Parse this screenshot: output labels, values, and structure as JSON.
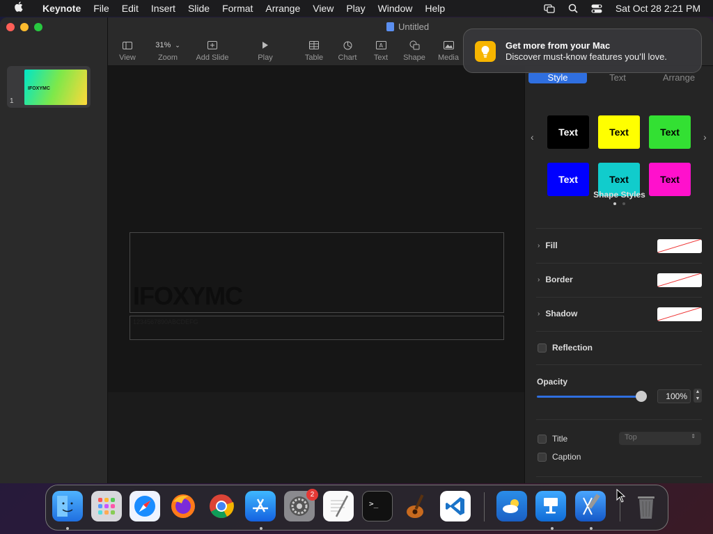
{
  "menubar": {
    "app_name": "Keynote",
    "items": [
      "File",
      "Edit",
      "Insert",
      "Slide",
      "Format",
      "Arrange",
      "View",
      "Play",
      "Window",
      "Help"
    ],
    "clock": "Sat Oct 28  2:21 PM"
  },
  "window": {
    "title": "Untitled"
  },
  "toolbar": {
    "view_label": "View",
    "zoom_value": "31%",
    "zoom_label": "Zoom",
    "add_slide_label": "Add Slide",
    "play_label": "Play",
    "table_label": "Table",
    "chart_label": "Chart",
    "text_label": "Text",
    "shape_label": "Shape",
    "media_label": "Media"
  },
  "navigator": {
    "slide_number": "1",
    "thumb_text": "IFOXYMC"
  },
  "slide": {
    "title_text": "IFOXYMC",
    "caption_text": "1234567890ABCDEFG"
  },
  "inspector": {
    "tabs": [
      "Style",
      "Text",
      "Arrange"
    ],
    "swatches": [
      {
        "label": "Text",
        "bg": "#000000",
        "fg": "#ffffff"
      },
      {
        "label": "Text",
        "bg": "#ffff00",
        "fg": "#000000"
      },
      {
        "label": "Text",
        "bg": "#33e033",
        "fg": "#000000"
      },
      {
        "label": "Text",
        "bg": "#0000ff",
        "fg": "#ffffff"
      },
      {
        "label": "Text",
        "bg": "#11cccc",
        "fg": "#000000"
      },
      {
        "label": "Text",
        "bg": "#ff11cc",
        "fg": "#000000"
      }
    ],
    "shape_styles_label": "Shape Styles",
    "fill_label": "Fill",
    "border_label": "Border",
    "shadow_label": "Shadow",
    "reflection_label": "Reflection",
    "opacity_label": "Opacity",
    "opacity_value": "100%",
    "opacity_level": 1.0,
    "title_label": "Title",
    "caption_label": "Caption",
    "position_value": "Top"
  },
  "notification": {
    "title": "Get more from your Mac",
    "body": "Discover must-know features you’ll love."
  },
  "dock": {
    "badge_count": "2"
  },
  "colors": {
    "accent": "#2f6fe0"
  }
}
